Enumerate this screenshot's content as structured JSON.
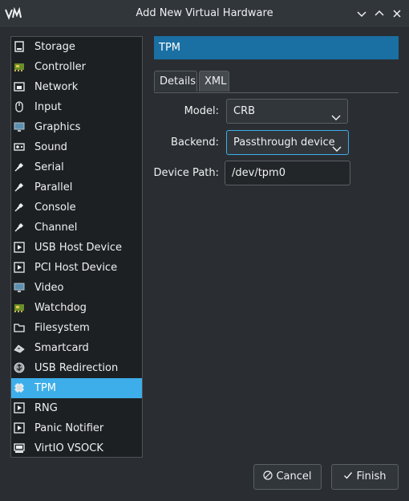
{
  "window": {
    "title": "Add New Virtual Hardware"
  },
  "sidebar": {
    "items": [
      {
        "label": "Storage",
        "icon": "disk-icon"
      },
      {
        "label": "Controller",
        "icon": "controller-chip-icon"
      },
      {
        "label": "Network",
        "icon": "network-icon"
      },
      {
        "label": "Input",
        "icon": "mouse-icon"
      },
      {
        "label": "Graphics",
        "icon": "monitor-icon"
      },
      {
        "label": "Sound",
        "icon": "sound-card-icon"
      },
      {
        "label": "Serial",
        "icon": "serial-plug-icon"
      },
      {
        "label": "Parallel",
        "icon": "parallel-plug-icon"
      },
      {
        "label": "Console",
        "icon": "console-plug-icon"
      },
      {
        "label": "Channel",
        "icon": "channel-plug-icon"
      },
      {
        "label": "USB Host Device",
        "icon": "usb-device-icon"
      },
      {
        "label": "PCI Host Device",
        "icon": "pci-device-icon"
      },
      {
        "label": "Video",
        "icon": "video-monitor-icon"
      },
      {
        "label": "Watchdog",
        "icon": "watchdog-chip-icon"
      },
      {
        "label": "Filesystem",
        "icon": "folder-icon"
      },
      {
        "label": "Smartcard",
        "icon": "smartcard-icon"
      },
      {
        "label": "USB Redirection",
        "icon": "usb-redirection-icon"
      },
      {
        "label": "TPM",
        "icon": "tpm-chip-icon",
        "selected": true
      },
      {
        "label": "RNG",
        "icon": "rng-device-icon"
      },
      {
        "label": "Panic Notifier",
        "icon": "panic-device-icon"
      },
      {
        "label": "VirtIO VSOCK",
        "icon": "vsock-icon"
      }
    ]
  },
  "main": {
    "header_title": "TPM",
    "tabs": [
      {
        "label": "Details",
        "active": true
      },
      {
        "label": "XML",
        "active": false
      }
    ],
    "form": {
      "model_label": "Model:",
      "model_value": "CRB",
      "backend_label": "Backend:",
      "backend_value": "Passthrough device",
      "device_path_label": "Device Path:",
      "device_path_value": "/dev/tpm0"
    }
  },
  "footer": {
    "cancel_label": "Cancel",
    "finish_label": "Finish"
  },
  "colors": {
    "accent": "#3daee9",
    "header": "#1a6fa3",
    "background": "#2a2e32"
  }
}
